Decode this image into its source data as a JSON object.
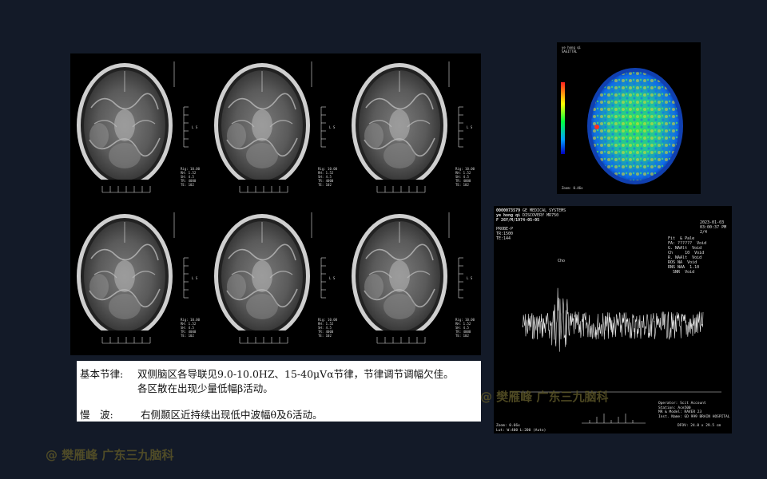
{
  "report": {
    "basic_rhythm_label": "基本节律:",
    "basic_rhythm_text_1": "双侧脑区各导联见9.0-10.0HZ、15-40μVα节律，节律调节调幅欠佳。",
    "basic_rhythm_text_2": "各区散在出现少量低幅β活动。",
    "slow_wave_label": "慢　波:",
    "slow_wave_text": "右侧颞区近持续出现低中波幅θ及δ活动。"
  },
  "watermarks": {
    "spectroscopy": "@ 樊雁峰 广东三九脑科",
    "page": "@ 樊雁峰 广东三九脑科"
  },
  "spectroscopy": {
    "header_left": "0000073579\nye hong qi\nF 26Y/M/1974-05-05",
    "header_mid": "GE MEDICAL SYSTEMS\nDISCOVERY MR750",
    "params_left": "PROBE-P\nTR:1500\nTE:144",
    "date_right": "2023-01-03\n03:00:37 PM\n2/4",
    "fit_labels": "Fit  & Pale\nFA: ??????  Void\nG. NAAlt  Void\nCh     10  Void\nR. NAAlt  Void\nROS NA  Void\nRNS NAA  1.10\n  SNR  Void",
    "peak_label": "Cho",
    "bottom_right": "Operator: Scit Account\nStation: Ace500\nMR & Model: RAVER 23\nInst. Name: GD 999 BRAIN HOSPITAL",
    "zoom": "Zoom: 0.66x",
    "window": "Lut: W:400 L:200 (Auto)",
    "fov": "DFOV: 24.0 x 29.5 cm"
  },
  "perfusion": {
    "top_label": "ye hong qi\nSAGITTAL",
    "bottom_label": "Zoom: 0.46x"
  },
  "mri": {
    "cells": [
      {
        "side_text": "Rig: 10.00\nRH: 1.52\nSH: 4.5\nTR: 4000\nTE: 102"
      },
      {
        "side_text": "Rig: 10.00\nRH: 1.52\nSH: 4.5\nTR: 4000\nTE: 102"
      },
      {
        "side_text": "Rig: 10.00\nRH: 1.52\nSH: 4.5\nTR: 4000\nTE: 102"
      },
      {
        "side_text": "Rig: 10.00\nRH: 1.52\nSH: 4.5\nTR: 4000\nTE: 102"
      },
      {
        "side_text": "Rig: 10.00\nRH: 1.52\nSH: 4.5\nTR: 4000\nTE: 102"
      },
      {
        "side_text": "Rig: 10.00\nRH: 1.52\nSH: 4.5\nTR: 4000\nTE: 102"
      }
    ]
  },
  "colors": {
    "background": "#131a28",
    "watermark": "#5a5427"
  }
}
